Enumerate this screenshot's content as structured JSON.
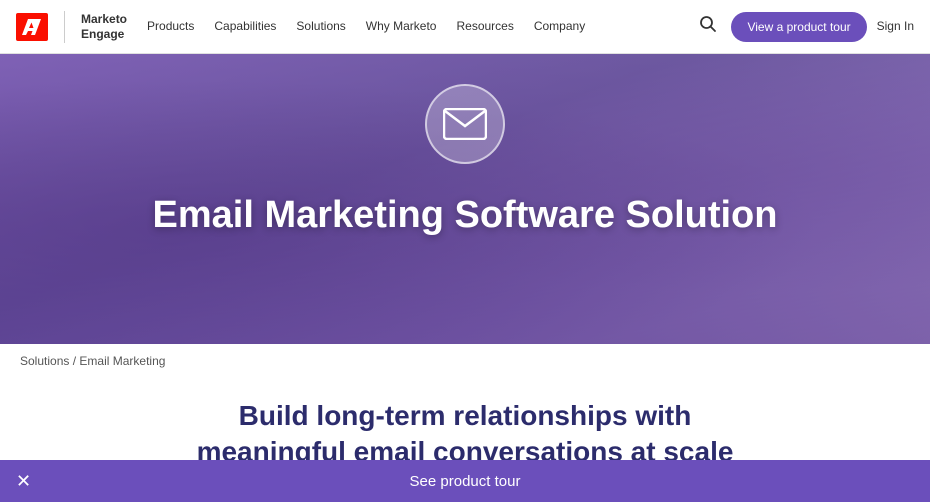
{
  "nav": {
    "logo": {
      "brand": "Adobe",
      "product_line1": "Marketo",
      "product_line2": "Engage"
    },
    "items": [
      {
        "id": "products",
        "label": "Products"
      },
      {
        "id": "capabilities",
        "label": "Capabilities"
      },
      {
        "id": "solutions",
        "label": "Solutions"
      },
      {
        "id": "why-marketo",
        "label": "Why Marketo"
      },
      {
        "id": "resources",
        "label": "Resources"
      },
      {
        "id": "company",
        "label": "Company"
      }
    ],
    "cta_label": "View a product tour",
    "sign_in_label": "Sign In"
  },
  "hero": {
    "icon_alt": "email",
    "title": "Email Marketing Software Solution"
  },
  "breadcrumb": {
    "parent": "Solutions",
    "separator": "/",
    "current": "Email Marketing"
  },
  "content": {
    "heading_line1": "Build long-term relationships with",
    "heading_line2": "meaningful email conversations at scale"
  },
  "bottom_banner": {
    "label": "See product tour",
    "close_icon": "✕"
  }
}
